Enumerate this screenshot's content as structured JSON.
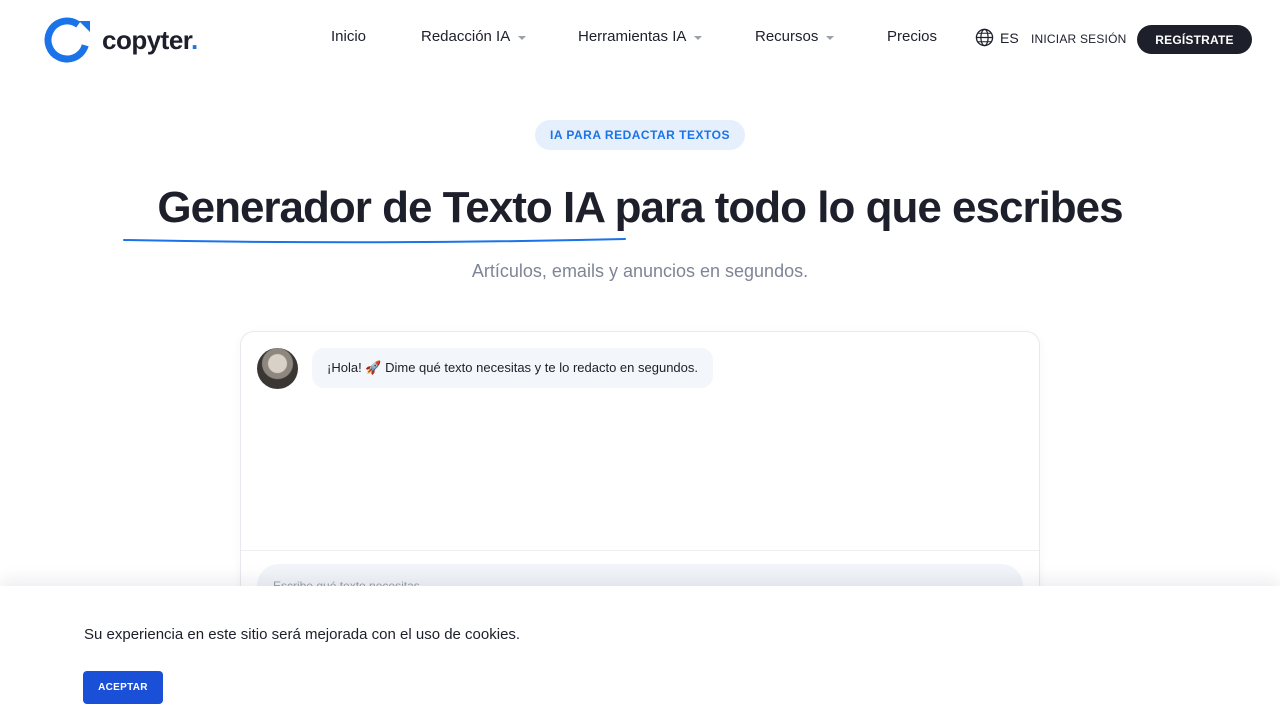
{
  "brand": {
    "name": "copyter",
    "dot": ".",
    "accent_color": "#1a73e8",
    "dark_color": "#1d1f2b"
  },
  "nav": {
    "items": [
      {
        "label": "Inicio",
        "has_dropdown": false
      },
      {
        "label": "Redacción IA",
        "has_dropdown": true
      },
      {
        "label": "Herramientas IA",
        "has_dropdown": true
      },
      {
        "label": "Recursos",
        "has_dropdown": true
      },
      {
        "label": "Precios",
        "has_dropdown": false
      }
    ],
    "language": {
      "icon": "globe-icon",
      "label": "ES"
    },
    "login_label": "INICIAR SESIÓN",
    "register_label": "REGÍSTRATE"
  },
  "hero": {
    "badge": "IA PARA REDACTAR TEXTOS",
    "title_highlight": "Generador de Texto IA",
    "title_rest": " para todo lo que escribes",
    "subtitle": "Artículos, emails y anuncios en segundos."
  },
  "chat": {
    "greeting_message": "¡Hola! 🚀 Dime qué texto necesitas y te lo redacto en segundos.",
    "input_placeholder": "Escribe qué texto necesitas"
  },
  "cookies": {
    "message": "Su experiencia en este sitio será mejorada con el uso de cookies.",
    "accept_label": "ACEPTAR",
    "button_color": "#1a4fd8"
  }
}
